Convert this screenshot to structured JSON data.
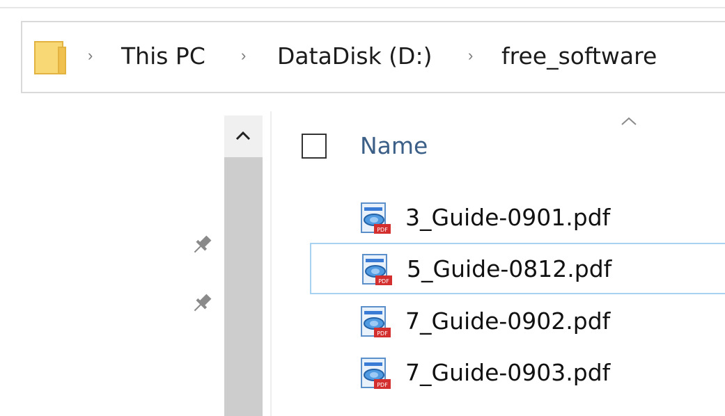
{
  "breadcrumb": {
    "items": [
      {
        "label": "This PC"
      },
      {
        "label": "DataDisk (D:)"
      },
      {
        "label": "free_software"
      }
    ],
    "separator": "›"
  },
  "file_list": {
    "column_name": "Name",
    "sort": "ascending",
    "files": [
      {
        "name": "3_Guide-0901.pdf",
        "icon": "pdf-file-icon",
        "selected": false
      },
      {
        "name": "5_Guide-0812.pdf",
        "icon": "pdf-file-icon",
        "selected": true
      },
      {
        "name": "7_Guide-0902.pdf",
        "icon": "pdf-file-icon",
        "selected": false
      },
      {
        "name": "7_Guide-0903.pdf",
        "icon": "pdf-file-icon",
        "selected": false
      }
    ]
  },
  "colors": {
    "accent_header": "#3c5f87",
    "selection_border": "#a8d2f2",
    "folder": "#f8d775"
  }
}
